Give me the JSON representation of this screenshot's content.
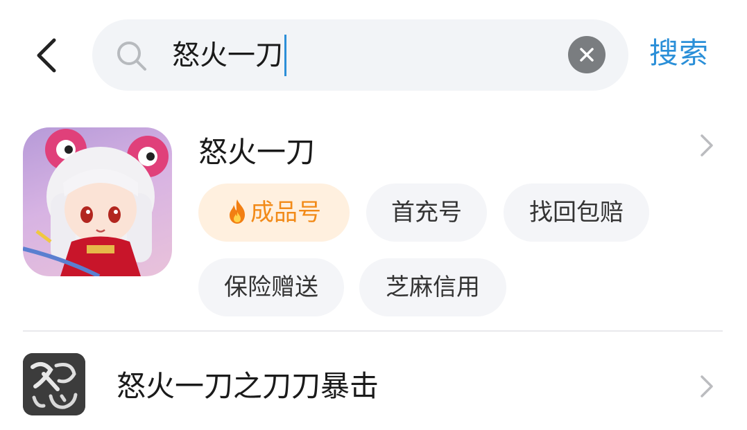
{
  "search": {
    "query": "怒火一刀",
    "submit_label": "搜索"
  },
  "results": [
    {
      "title": "怒火一刀",
      "tags": [
        "成品号",
        "首充号",
        "找回包赔",
        "保险赠送",
        "芝麻信用"
      ]
    },
    {
      "title": "怒火一刀之刀刀暴击"
    }
  ],
  "colors": {
    "accent": "#2a8fd8",
    "hot_tag_text": "#f28a18",
    "hot_tag_bg": "#fff0df",
    "tag_bg": "#f4f5f8",
    "search_bg": "#f2f4f7"
  }
}
